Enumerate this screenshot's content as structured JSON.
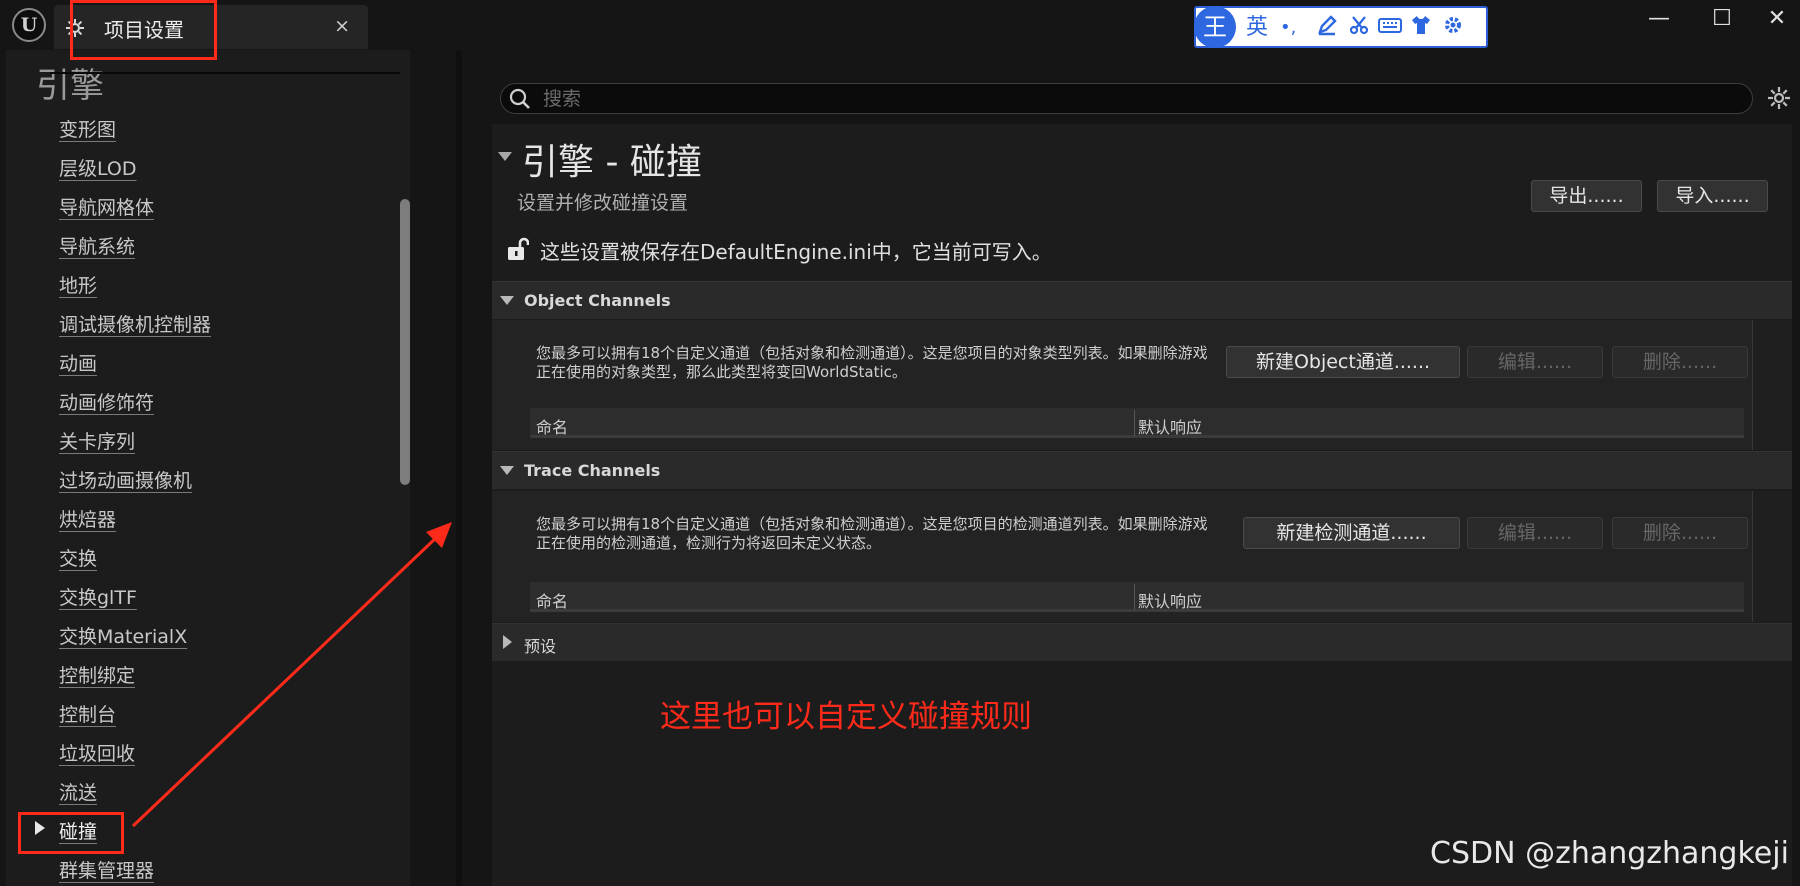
{
  "titlebar": {
    "logo": "U",
    "tab_label": "项目设置",
    "tab_close": "×",
    "window_controls": {
      "minimize": "—",
      "maximize": "☐",
      "close": "✕"
    }
  },
  "ime_toolbar": {
    "badge": "王",
    "mode": "英",
    "punct": "•,",
    "icons": [
      "pen-icon",
      "scissors-icon",
      "keyboard-icon",
      "shirt-icon",
      "gear-icon"
    ]
  },
  "sidebar": {
    "section": "引擎",
    "items": [
      "变形图",
      "层级LOD",
      "导航网格体",
      "导航系统",
      "地形",
      "调试摄像机控制器",
      "动画",
      "动画修饰符",
      "关卡序列",
      "过场动画摄像机",
      "烘焙器",
      "交换",
      "交换glTF",
      "交换MaterialX",
      "控制绑定",
      "控制台",
      "垃圾回收",
      "流送",
      "碰撞",
      "群集管理器"
    ],
    "selected": "碰撞"
  },
  "search": {
    "placeholder": "搜索"
  },
  "page": {
    "title": "引擎 - 碰撞",
    "subtitle": "设置并修改碰撞设置",
    "export_label": "导出......",
    "import_label": "导入......",
    "save_notice": "这些设置被保存在DefaultEngine.ini中，它当前可写入。"
  },
  "object_channels": {
    "title": "Object Channels",
    "description": "您最多可以拥有18个自定义通道（包括对象和检测通道）。这是您项目的对象类型列表。如果删除游戏正在使用的对象类型，那么此类型将变回WorldStatic。",
    "new_label": "新建Object通道......",
    "edit_label": "编辑......",
    "delete_label": "删除......",
    "col_name": "命名",
    "col_response": "默认响应"
  },
  "trace_channels": {
    "title": "Trace Channels",
    "description": "您最多可以拥有18个自定义通道（包括对象和检测通道）。这是您项目的检测通道列表。如果删除游戏正在使用的检测通道，检测行为将返回未定义状态。",
    "new_label": "新建检测通道......",
    "edit_label": "编辑......",
    "delete_label": "删除......",
    "col_name": "命名",
    "col_response": "默认响应"
  },
  "presets": {
    "title": "预设"
  },
  "annotation": {
    "text": "这里也可以自定义碰撞规则",
    "color": "#ff2a1a"
  },
  "watermark": "CSDN @zhangzhangkeji",
  "colors": {
    "background": "#151515",
    "panel": "#1c1c1c",
    "category": "#2a2a2a",
    "annotation_red": "#ff2a1a",
    "ime_blue": "#2d68e0"
  }
}
